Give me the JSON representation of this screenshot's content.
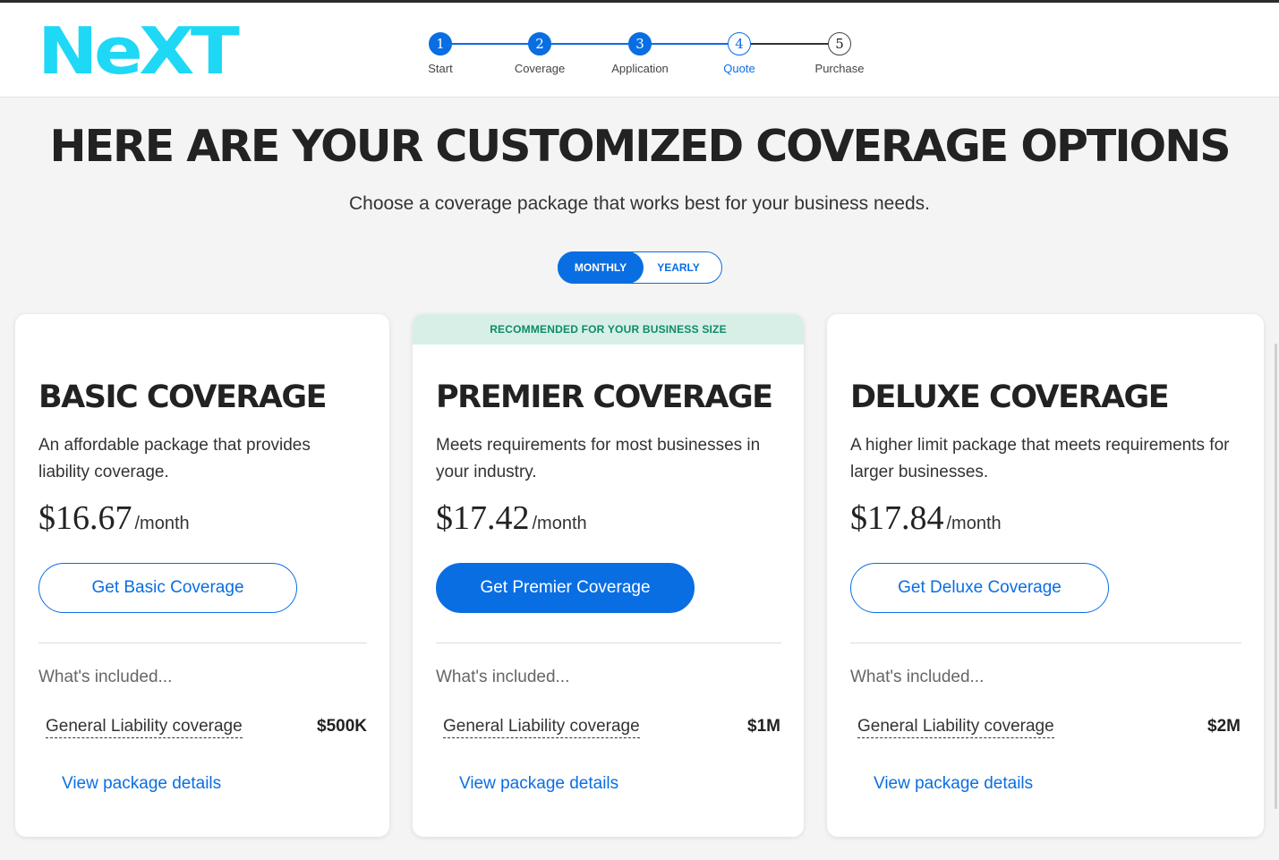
{
  "brand": {
    "logo_text": "NeXT",
    "accent": "#1ed8f5"
  },
  "colors": {
    "primary": "#0a6ee3",
    "recommended_bg": "#d8efe8",
    "recommended_text": "#0d8b67"
  },
  "stepper": {
    "steps": [
      {
        "number": "1",
        "label": "Start",
        "state": "done"
      },
      {
        "number": "2",
        "label": "Coverage",
        "state": "done"
      },
      {
        "number": "3",
        "label": "Application",
        "state": "done"
      },
      {
        "number": "4",
        "label": "Quote",
        "state": "current"
      },
      {
        "number": "5",
        "label": "Purchase",
        "state": "todo"
      }
    ]
  },
  "main": {
    "headline": "Here are your customized coverage options",
    "subhead": "Choose a coverage package that works best for your business needs.",
    "billing_toggle": {
      "monthly": "MONTHLY",
      "yearly": "YEARLY",
      "selected": "MONTHLY"
    }
  },
  "cards": [
    {
      "title": "Basic Coverage",
      "description": "An affordable package that provides liability coverage.",
      "price": "$16.67",
      "period": "/month",
      "button": "Get Basic Coverage",
      "included_title": "What's included...",
      "coverage_name": "General Liability coverage",
      "coverage_value": "$500K",
      "details_link": "View package details"
    },
    {
      "banner": "RECOMMENDED FOR YOUR BUSINESS SIZE",
      "title": "Premier Coverage",
      "description": "Meets requirements for most businesses in your industry.",
      "price": "$17.42",
      "period": "/month",
      "button": "Get Premier Coverage",
      "included_title": "What's included...",
      "coverage_name": "General Liability coverage",
      "coverage_value": "$1M",
      "details_link": "View package details"
    },
    {
      "title": "Deluxe Coverage",
      "description": "A higher limit package that meets requirements for larger businesses.",
      "price": "$17.84",
      "period": "/month",
      "button": "Get Deluxe Coverage",
      "included_title": "What's included...",
      "coverage_name": "General Liability coverage",
      "coverage_value": "$2M",
      "details_link": "View package details"
    }
  ]
}
